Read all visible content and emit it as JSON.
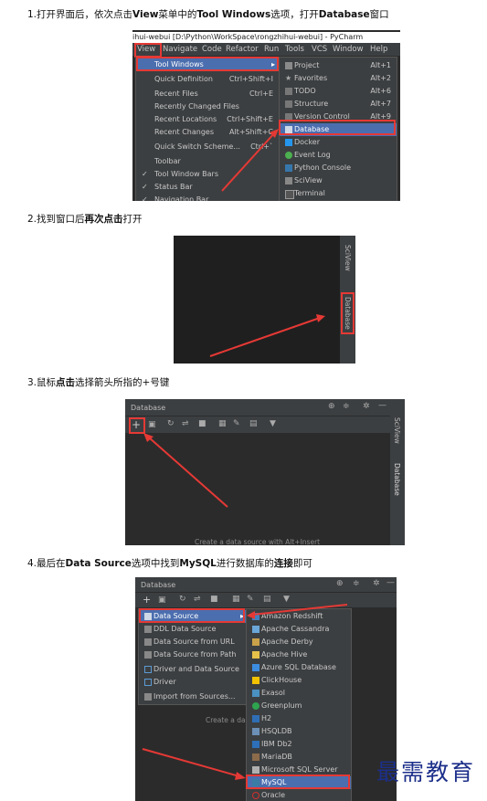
{
  "steps": [
    {
      "prefix": "1.打开界面后，依次点击",
      "b1": "View",
      "mid": "菜单中的",
      "b2": "Tool Windows",
      "suffix": "选项，打开",
      "b3": "Database",
      "end": "窗口"
    },
    {
      "prefix": "2.找到窗口后",
      "b1": "再次点击",
      "suffix": "打开"
    },
    {
      "prefix": "3.鼠标",
      "b1": "点击",
      "suffix": "选择箭头所指的+号键"
    },
    {
      "prefix": "4.最后在",
      "b1": "Data Source",
      "mid": "选项中找到",
      "b2": "MySQL",
      "suffix": "进行数据库的",
      "b3": "连接",
      "end": "即可"
    }
  ],
  "shot1": {
    "title": "ihui-webui [D:\\Python\\WorkSpace\\rongzhihui-webui] - PyCharm",
    "menubar": [
      "View",
      "Navigate",
      "Code",
      "Refactor",
      "Run",
      "Tools",
      "VCS",
      "Window",
      "Help"
    ],
    "view_menu": [
      {
        "label": "Tool Windows",
        "key": ""
      },
      {
        "label": "Quick Definition",
        "key": "Ctrl+Shift+I"
      },
      {
        "label": "Recent Files",
        "key": "Ctrl+E"
      },
      {
        "label": "Recently Changed Files",
        "key": ""
      },
      {
        "label": "Recent Locations",
        "key": "Ctrl+Shift+E"
      },
      {
        "label": "Recent Changes",
        "key": "Alt+Shift+C"
      },
      {
        "label": "Quick Switch Scheme...",
        "key": "Ctrl+`"
      },
      {
        "label": "Toolbar",
        "key": ""
      },
      {
        "label": "Tool Window Bars",
        "key": ""
      },
      {
        "label": "Status Bar",
        "key": ""
      },
      {
        "label": "Navigation Bar",
        "key": ""
      }
    ],
    "tool_windows": [
      {
        "label": "Project",
        "key": "Alt+1"
      },
      {
        "label": "Favorites",
        "key": "Alt+2"
      },
      {
        "label": "TODO",
        "key": "Alt+6"
      },
      {
        "label": "Structure",
        "key": "Alt+7"
      },
      {
        "label": "Version Control",
        "key": "Alt+9"
      },
      {
        "label": "Database",
        "key": ""
      },
      {
        "label": "Docker",
        "key": ""
      },
      {
        "label": "Event Log",
        "key": ""
      },
      {
        "label": "Python Console",
        "key": ""
      },
      {
        "label": "SciView",
        "key": ""
      },
      {
        "label": "Terminal",
        "key": ""
      }
    ]
  },
  "shot2": {
    "tab_sciview": "SciView",
    "tab_database": "Database"
  },
  "shot3": {
    "title": "Database",
    "hint": "Create a data source with Alt+Insert",
    "tab_sciview": "SciView",
    "tab_database": "Database"
  },
  "shot4": {
    "title": "Database",
    "hint": "Create a da",
    "add_menu": [
      {
        "label": "Data Source"
      },
      {
        "label": "DDL Data Source"
      },
      {
        "label": "Data Source from URL"
      },
      {
        "label": "Data Source from Path"
      },
      {
        "label": "Driver and Data Source"
      },
      {
        "label": "Driver"
      },
      {
        "label": "Import from Sources..."
      }
    ],
    "drivers": [
      "Amazon Redshift",
      "Apache Cassandra",
      "Apache Derby",
      "Apache Hive",
      "Azure SQL Database",
      "ClickHouse",
      "Exasol",
      "Greenplum",
      "H2",
      "HSQLDB",
      "IBM Db2",
      "MariaDB",
      "Microsoft SQL Server",
      "MySQL",
      "Oracle"
    ],
    "driver_colors": [
      "#3f7fbf",
      "#6aa6d8",
      "#c9a14a",
      "#e6c14a",
      "#3c8de0",
      "#f2c200",
      "#4a90c0",
      "#2ea44f",
      "#2f6eb5",
      "#6c8fb5",
      "#2d6fb8",
      "#8b6b4a",
      "#b0b0b0",
      "#3a7ca5",
      "#d32f2f"
    ]
  },
  "watermark": "最需教育",
  "colors": {
    "accent_red": "#e53935",
    "selection": "#4b6eaf",
    "ide_bg": "#3c3f41"
  }
}
